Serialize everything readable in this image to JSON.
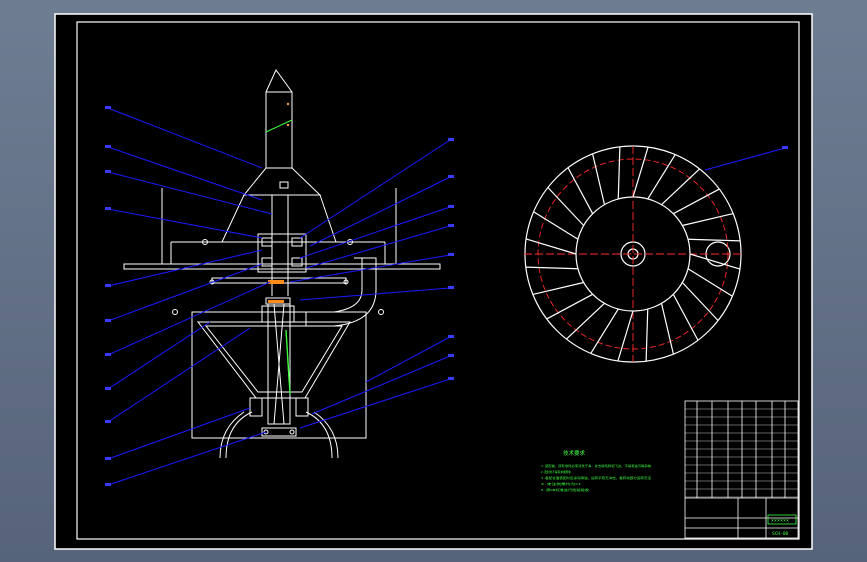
{
  "drawing": {
    "background": "#000000",
    "frame_color": "#ffffff",
    "leader_color": "#1a1aff",
    "center_line_color": "#ff2a2a",
    "note_color": "#3dff3d",
    "part_color": "#ffffff"
  },
  "notes": {
    "title": "技术要求",
    "lines": [
      "1.装配前，所有零件必须清洗干净，并去除毛刺和飞边，不得有油污等杂物",
      "2.密封处不得有渗漏现象",
      "3.各配合面装配时应涂润滑油，运转平稳无冲击，各转动部分运转灵活",
      "4.未注倒角均为C1",
      "5.按GB标准进行检验验收"
    ]
  },
  "title_block": {
    "drawing_name": "××××××",
    "drawing_number": "SCH-00"
  }
}
